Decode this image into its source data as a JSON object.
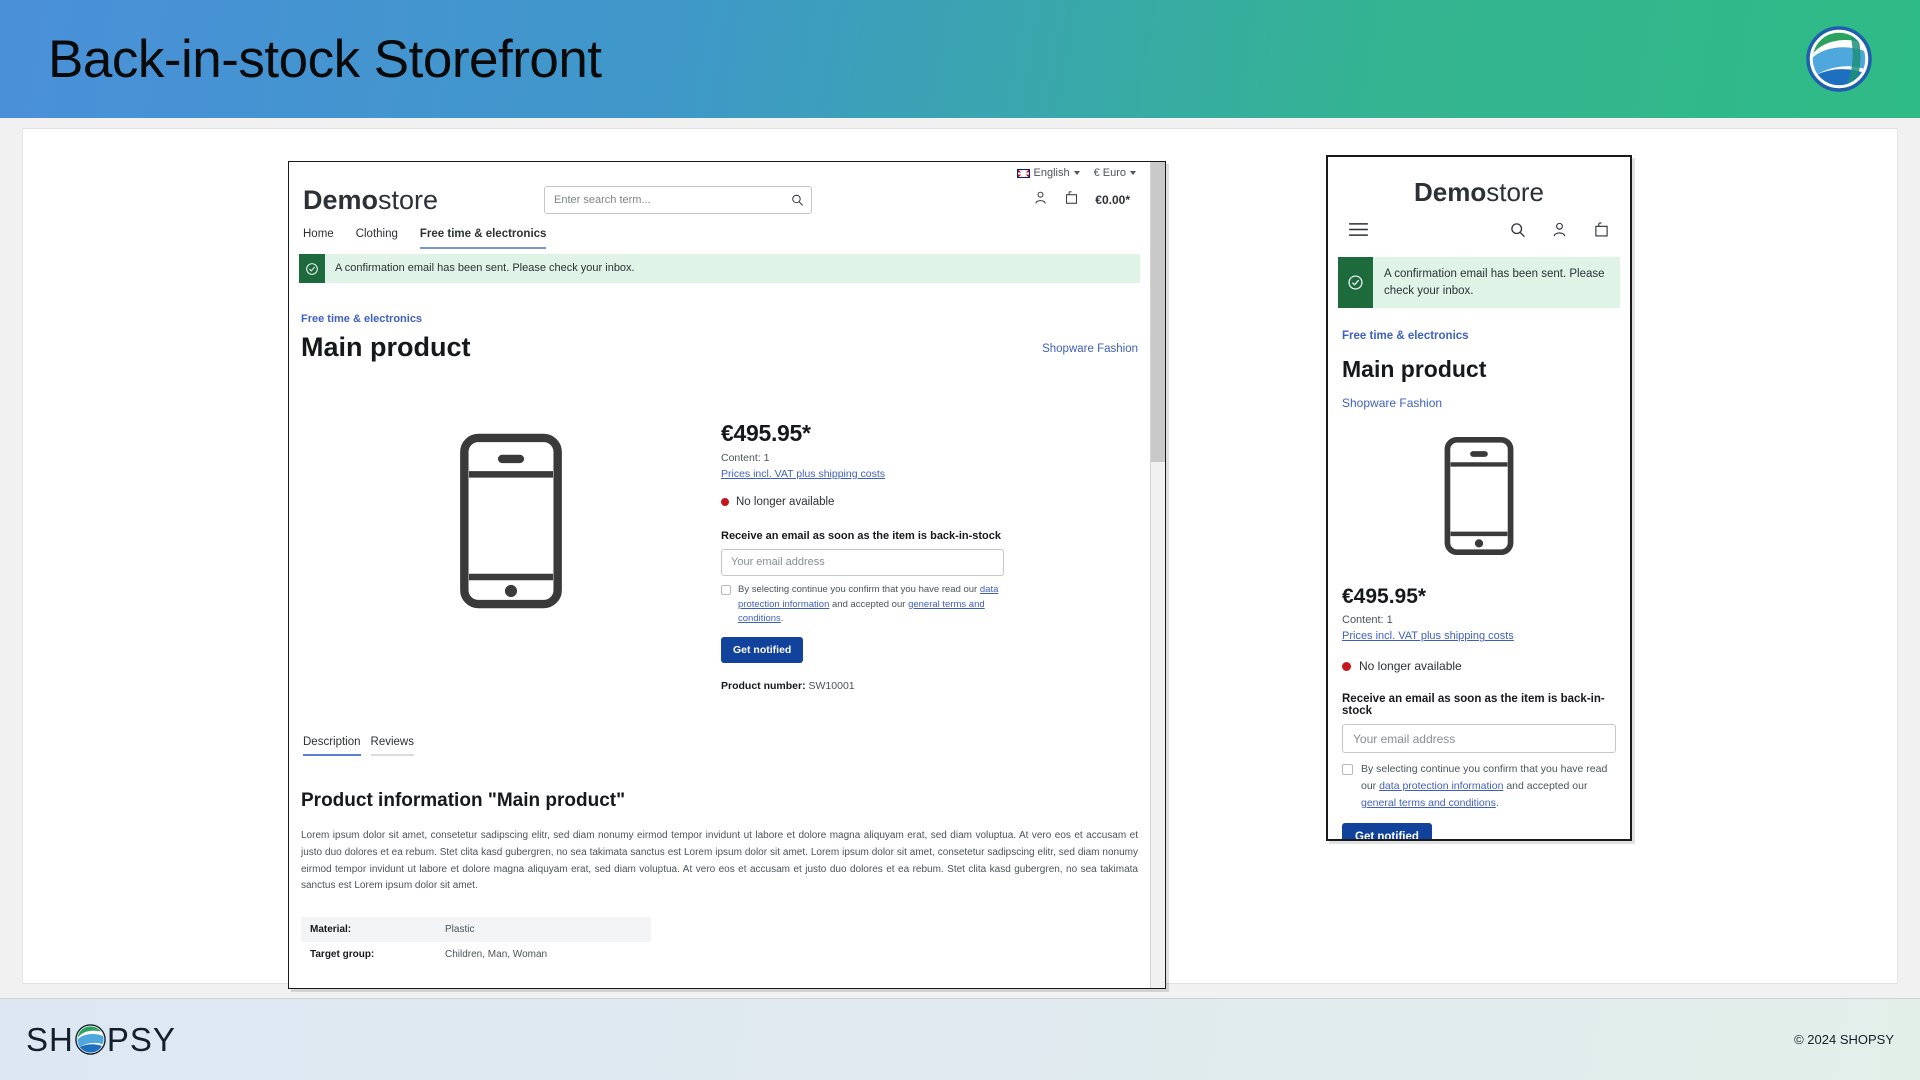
{
  "banner": {
    "title": "Back-in-stock Storefront",
    "logo_icon": "shopsy-circle-logo"
  },
  "desktop": {
    "locale": {
      "flag_icon": "uk-flag-icon",
      "language": "English",
      "currency": "€ Euro"
    },
    "brand": {
      "bold": "Demo",
      "light": "store"
    },
    "search": {
      "placeholder": "Enter search term...",
      "icon": "search-icon"
    },
    "actions": {
      "account_icon": "account-icon",
      "cart_icon": "shopping-bag-icon",
      "cart_total": "€0.00*"
    },
    "nav": [
      {
        "label": "Home",
        "active": false
      },
      {
        "label": "Clothing",
        "active": false
      },
      {
        "label": "Free time & electronics",
        "active": true
      }
    ],
    "alert": {
      "icon": "check-circle-icon",
      "message": "A confirmation email has been sent. Please check your inbox."
    },
    "breadcrumb": "Free time & electronics",
    "product_title": "Main product",
    "manufacturer": "Shopware Fashion",
    "gallery_icon": "smartphone-product-image",
    "price": "€495.95*",
    "content": "Content: 1",
    "vat_link": "Prices incl. VAT plus shipping costs",
    "stock_status": "No longer available",
    "stock_dot_color": "#c4161c",
    "notify_label": "Receive an email as soon as the item is back-in-stock",
    "email_placeholder": "Your email address",
    "email_value": "",
    "consent": {
      "part1": "By selecting continue you confirm that you have read our ",
      "link1": "data protection information",
      "part2": " and accepted our ",
      "link2": "general terms and conditions",
      "part3": "."
    },
    "notify_button": "Get notified",
    "product_number_label": "Product number:",
    "product_number_value": "SW10001",
    "tabs": [
      {
        "label": "Description",
        "active": true
      },
      {
        "label": "Reviews",
        "active": false
      }
    ],
    "description_heading": "Product information \"Main product\"",
    "description_body": "Lorem ipsum dolor sit amet, consetetur sadipscing elitr, sed diam nonumy eirmod tempor invidunt ut labore et dolore magna aliquyam erat, sed diam voluptua. At vero eos et accusam et justo duo dolores et ea rebum. Stet clita kasd gubergren, no sea takimata sanctus est Lorem ipsum dolor sit amet. Lorem ipsum dolor sit amet, consetetur sadipscing elitr, sed diam nonumy eirmod tempor invidunt ut labore et dolore magna aliquyam erat, sed diam voluptua. At vero eos et accusam et justo duo dolores et ea rebum. Stet clita kasd gubergren, no sea takimata sanctus est Lorem ipsum dolor sit amet.",
    "properties": [
      {
        "key": "Material:",
        "value": "Plastic"
      },
      {
        "key": "Target group:",
        "value": "Children, Man, Woman"
      }
    ]
  },
  "mobile": {
    "brand": {
      "bold": "Demo",
      "light": "store"
    },
    "icons": {
      "menu": "hamburger-menu-icon",
      "search": "search-icon",
      "account": "account-icon",
      "cart": "shopping-bag-icon"
    },
    "alert": {
      "icon": "check-circle-icon",
      "message": "A confirmation email has been sent. Please check your inbox."
    },
    "breadcrumb": "Free time & electronics",
    "product_title": "Main product",
    "manufacturer": "Shopware Fashion",
    "gallery_icon": "smartphone-product-image",
    "price": "€495.95*",
    "content": "Content: 1",
    "vat_link": "Prices incl. VAT plus shipping costs",
    "stock_status": "No longer available",
    "notify_label": "Receive an email as soon as the item is back-in-stock",
    "email_placeholder": "Your email address",
    "email_value": "",
    "consent": {
      "part1": "By selecting continue you confirm that you have read our ",
      "link1": "data protection information",
      "part2": " and accepted our ",
      "link2": "general terms and conditions",
      "part3": "."
    },
    "notify_button": "Get notified"
  },
  "footer": {
    "brand_before": "SH",
    "brand_after": "PSY",
    "logo_icon": "shopsy-circle-logo",
    "copyright": "© 2024 SHOPSY"
  },
  "colors": {
    "banner_start": "#4a90d9",
    "banner_end": "#2fbb86",
    "primary_button": "#11429c",
    "link": "#3f5fbf",
    "alert_bg": "#dff3e6",
    "alert_icon_bg": "#1d6b3c",
    "stock_red": "#c4161c"
  }
}
